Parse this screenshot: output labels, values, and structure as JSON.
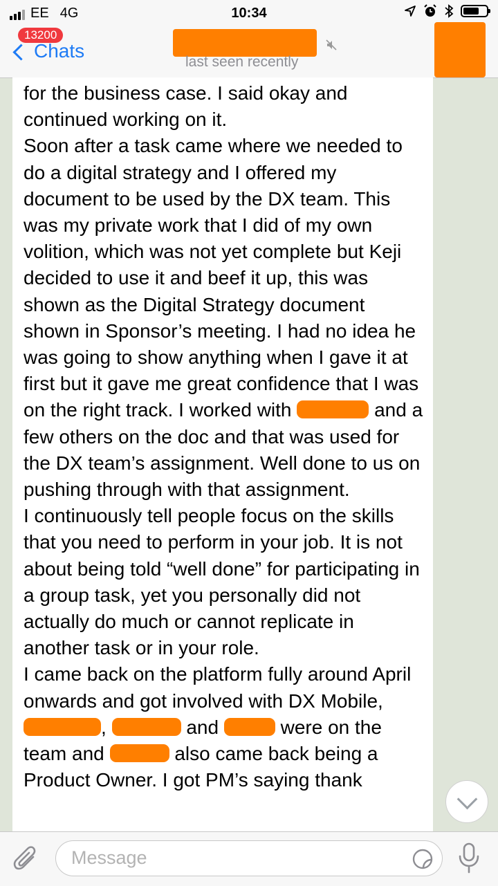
{
  "status": {
    "carrier": "EE",
    "network": "4G",
    "time": "10:34"
  },
  "nav": {
    "badge": "13200",
    "back_label": "Chats",
    "subtitle": "last seen recently"
  },
  "message": {
    "segments": [
      "for the business case. I said okay and continued working on it.",
      "Soon after a task came where we needed to do a digital strategy and I offered my document to be used by the DX team. This was my private work that I did of my own volition, which was not yet complete but Keji decided to use it and beef it up, this was shown as the Digital Strategy document shown in Sponsor’s meeting. I had no idea he was going to show anything when I gave it at first but it gave me great confidence that I was on the right track. I worked with",
      "and a few others on the doc and that was used for the DX team’s assignment. Well done to us on pushing through with that assignment.",
      "I continuously tell people focus on the skills that you need to perform in your job. It is not about being told “well done” for participating in a group task, yet you personally did not actually do much or cannot replicate in another task or in your role.",
      "I came back on the platform fully around April onwards and got involved with DX Mobile,",
      ",",
      "and",
      "were on the team and",
      "also came back being a Product Owner. I got PM’s saying thank"
    ]
  },
  "input": {
    "placeholder": "Message"
  },
  "colors": {
    "accent": "#1e7bf5",
    "badge": "#f0393e",
    "redaction": "#ff7f00",
    "wallpaper": "#dfe5d9"
  }
}
